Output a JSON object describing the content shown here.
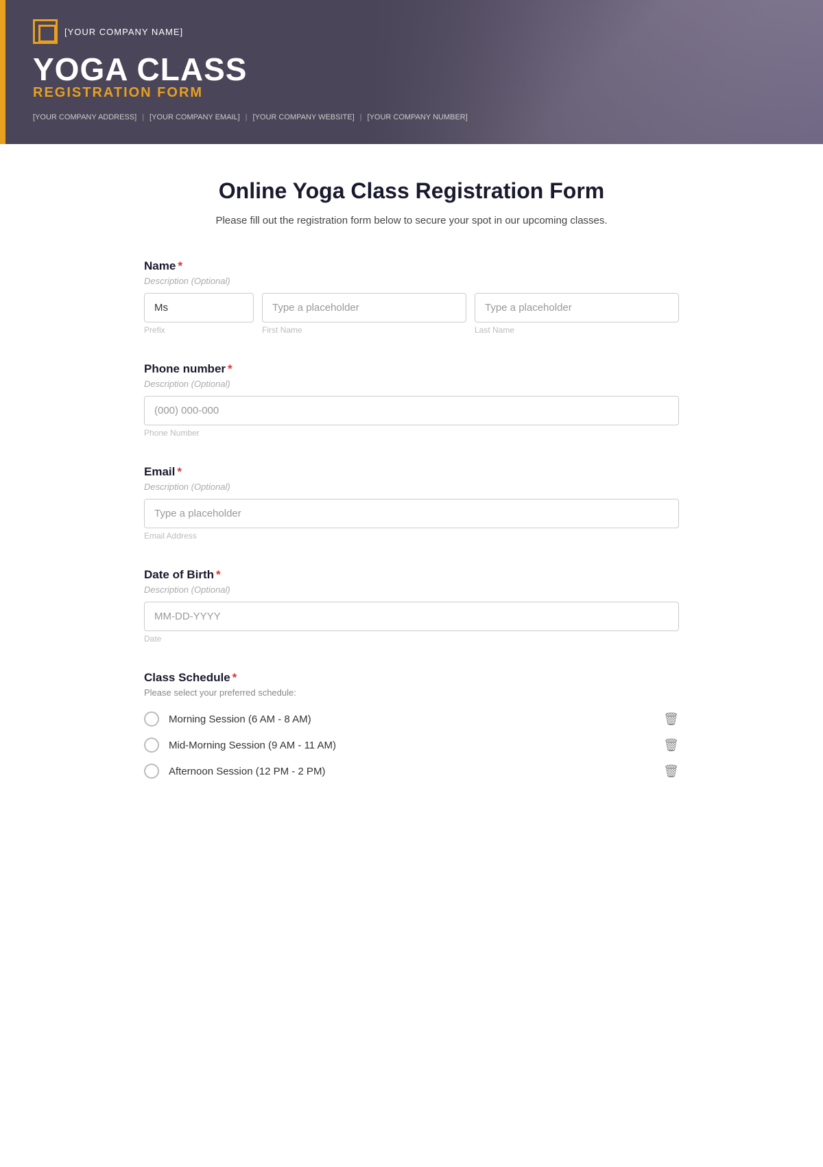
{
  "header": {
    "company_name": "[YOUR COMPANY NAME]",
    "title_line1": "YOGA CLASS",
    "title_line2": "REGISTRATION FORM",
    "address": "[YOUR COMPANY ADDRESS]",
    "email": "[YOUR COMPANY EMAIL]",
    "website": "[YOUR COMPANY WEBSITE]",
    "number": "[YOUR COMPANY NUMBER]",
    "accent_color": "#e8a020",
    "bg_color": "#4a4558"
  },
  "form": {
    "main_title": "Online Yoga Class Registration Form",
    "description": "Please fill out the registration form below to secure your spot in our upcoming classes.",
    "fields": {
      "name": {
        "label": "Name",
        "description": "Description (Optional)",
        "prefix_value": "Ms",
        "first_placeholder": "Type a placeholder",
        "last_placeholder": "Type a placeholder",
        "prefix_sublabel": "Prefix",
        "first_sublabel": "First Name",
        "last_sublabel": "Last Name"
      },
      "phone": {
        "label": "Phone number",
        "description": "Description (Optional)",
        "placeholder": "(000) 000-000",
        "sublabel": "Phone Number"
      },
      "email": {
        "label": "Email",
        "description": "Description (Optional)",
        "placeholder": "Type a placeholder",
        "sublabel": "Email Address"
      },
      "dob": {
        "label": "Date of Birth",
        "description": "Description (Optional)",
        "placeholder": "MM-DD-YYYY",
        "sublabel": "Date"
      },
      "class_schedule": {
        "label": "Class Schedule",
        "description": "Please select your preferred schedule:",
        "options": [
          {
            "label": "Morning Session (6 AM - 8 AM)"
          },
          {
            "label": "Mid-Morning Session (9 AM - 11 AM)"
          },
          {
            "label": "Afternoon Session (12 PM - 2 PM)"
          }
        ]
      }
    }
  },
  "icons": {
    "delete": "🗑",
    "logo_bracket": "⬜"
  }
}
